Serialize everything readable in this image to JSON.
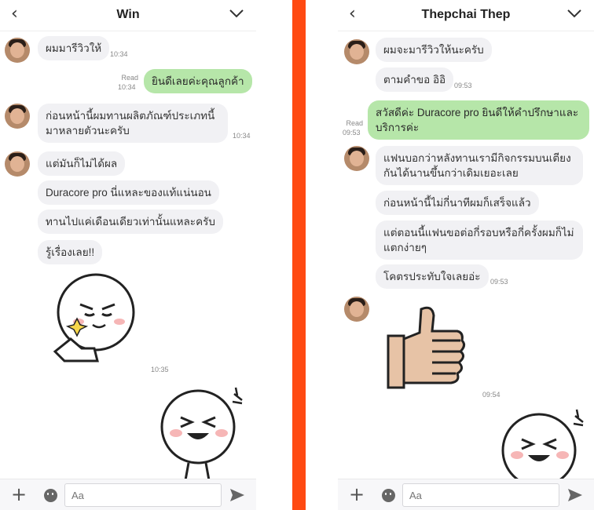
{
  "left": {
    "header": {
      "title": "Win"
    },
    "messages": [
      {
        "text": "ผมมารีวิวให้",
        "time": "10:34"
      },
      {
        "text": "ยินดีเลยค่ะคุณลูกค้า",
        "read": "Read",
        "time": "10:34"
      },
      {
        "text_line1": "ก่อนหน้านี้ผมทานผลิตภัณฑ์ประเภทนี้",
        "text_line2": "มาหลายตัวนะครับ",
        "time": "10:34"
      },
      {
        "text": "แต่มันก็ไม่ได้ผล"
      },
      {
        "text": "Duracore pro นี่แหละของแท้แน่นอน"
      },
      {
        "text": "ทานไปแค่เดือนเดียวเท่านั้นแหละครับ"
      },
      {
        "text": "รู้เรื่องเลย!!"
      }
    ],
    "sticker_time": "10:35",
    "input_placeholder": "Aa"
  },
  "right": {
    "header": {
      "title": "Thepchai Thep"
    },
    "messages": [
      {
        "text": "ผมจะมารีวิวให้นะครับ"
      },
      {
        "text": "ตามคำขอ อิอิ",
        "time": "09:53"
      },
      {
        "text_line1": "สวัสดีค่ะ Duracore pro ยินดีให้คำปรึกษาและ",
        "text_line2": "บริการค่ะ",
        "read": "Read",
        "time": "09:53"
      },
      {
        "text_line1": "แฟนบอกว่าหลังทานเรามีกิจกรรมบนเตียง",
        "text_line2": "กันได้นานขึ้นกว่าเดิมเยอะเลย"
      },
      {
        "text": "ก่อนหน้านี้ไม่กี่นาทีผมก็เสร็จแล้ว"
      },
      {
        "text_line1": "แต่ตอนนี้แฟนขอต่อกี่รอบหรือกี่ครั้งผมก็ไม่",
        "text_line2": "แตกง่ายๆ"
      },
      {
        "text": "โคตรประทับใจเลยอ่ะ",
        "time": "09:53"
      }
    ],
    "sticker_time": "09:54",
    "input_placeholder": "Aa"
  },
  "colors": {
    "divider": "#ff4a12",
    "outgoing_bubble": "#b6e6a9",
    "incoming_bubble": "#f1f1f4"
  },
  "icons": [
    "back-arrow-icon",
    "chevron-down-icon",
    "plus-icon",
    "emoji-icon",
    "send-icon",
    "thumbs-up-sticker",
    "line-moon-sticker"
  ]
}
